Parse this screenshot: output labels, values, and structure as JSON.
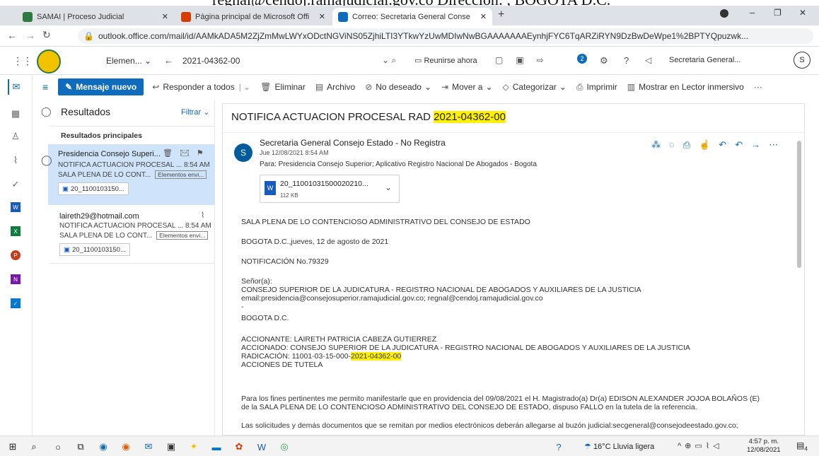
{
  "top_cut_text": "regnal@cendoj.ramajudicial.gov.co Dirección: , BOGOTA D.C.",
  "tabs": [
    {
      "title": "SAMAI | Proceso Judicial",
      "color": "#2b7a3f"
    },
    {
      "title": "Página principal de Microsoft Offi",
      "color": "#d83b01"
    },
    {
      "title": "Correo: Secretaria General Conse",
      "color": "#0f6cbd"
    }
  ],
  "url": "outlook.office.com/mail/id/AAMkADA5M2ZjZmMwLWYxODctNGViNS05ZjhiLTI3YTkwYzUwMDIwNwBGAAAAAAAEynhjFYC6TqARZiRYN9DzBwDeWpe1%2BPTYQpuzwk...",
  "header": {
    "folder": "Elemen...",
    "search": "2021-04362-00",
    "meet": "Reunirse ahora",
    "account": "Secretaria General...",
    "avatar": "S",
    "notif": "2"
  },
  "toolbar": {
    "new": "Mensaje nuevo",
    "reply_all": "Responder a todos",
    "delete": "Eliminar",
    "archive": "Archivo",
    "junk": "No deseado",
    "move": "Mover a",
    "categorize": "Categorizar",
    "print": "Imprimir",
    "immersive": "Mostrar en Lector inmersivo",
    "more": "···"
  },
  "list": {
    "title": "Resultados",
    "filter": "Filtrar",
    "section": "Resultados principales",
    "items": [
      {
        "sender": "Presidencia Consejo Superi...",
        "subject": "NOTIFICA ACTUACION PROCESAL ...",
        "time": "8:54 AM",
        "preview": "SALA PLENA DE LO CONT...",
        "badge": "Elementos envi...",
        "att": "20_1100103150..."
      },
      {
        "sender": "laireth29@hotmail.com",
        "subject": "NOTIFICA ACTUACION PROCESAL ...",
        "time": "8:54 AM",
        "preview": "SALA PLENA DE LO CONT...",
        "badge": "Elementos envi...",
        "att": "20_1100103150..."
      }
    ]
  },
  "message": {
    "subject_prefix": "NOTIFICA ACTUACION PROCESAL RAD ",
    "subject_hl": "2021-04362-00",
    "from": "Secretaria General Consejo Estado - No Registra",
    "date": "Jue 12/08/2021 8:54 AM",
    "to": "Para:  Presidencia Consejo Superior; Aplicativo Registro Nacional De Abogados - Bogota",
    "att_name": "20_11001031500020210...",
    "att_size": "112 KB",
    "avatar": "S",
    "body": [
      "SALA PLENA DE LO CONTENCIOSO ADMINISTRATIVO DEL CONSEJO DE ESTADO",
      "BOGOTA D.C.,jueves, 12 de agosto de 2021",
      "NOTIFICACIÓN No.79329",
      "Señor(a):",
      "CONSEJO SUPERIOR DE LA JUDICATURA - REGISTRO NACIONAL DE ABOGADOS Y AUXILIARES DE LA JUSTICIA",
      "email:presidencia@consejosuperior.ramajudicial.gov.co; regnal@cendoj.ramajudicial.gov.co",
      "-",
      "BOGOTA D.C.",
      "ACCIONANTE: LAIRETH PATRICIA CABEZA GUTIERREZ",
      "ACCIONADO: CONSEJO SUPERIOR DE LA JUDICATURA - REGISTRO NACIONAL DE ABOGADOS Y AUXILIARES DE LA JUSTICIA",
      "RADICACIÓN: 11001-03-15-000-",
      "ACCIONES DE TUTELA",
      "Para los fines pertinentes me permito manifestarle que en providencia del 09/08/2021  el H. Magistrado(a) Dr(a) EDISON ALEXANDER JOJOA BOLAÑOS (E)",
      "de la SALA PLENA DE LO CONTENCIOSO ADMINISTRATIVO DEL CONSEJO DE ESTADO, dispuso FALLO en la tutela de la referencia.",
      "Las solicitudes y demás documentos que se remitan por medios electrónicos deberán allegarse al buzón judicial:secgeneral@consejodeestado.gov.co;"
    ],
    "rad_hl": "2021-04362-00"
  },
  "taskbar": {
    "weather": "16°C  Lluvia ligera",
    "time": "4:57 p. m.",
    "date": "12/08/2021",
    "notif": "4"
  }
}
